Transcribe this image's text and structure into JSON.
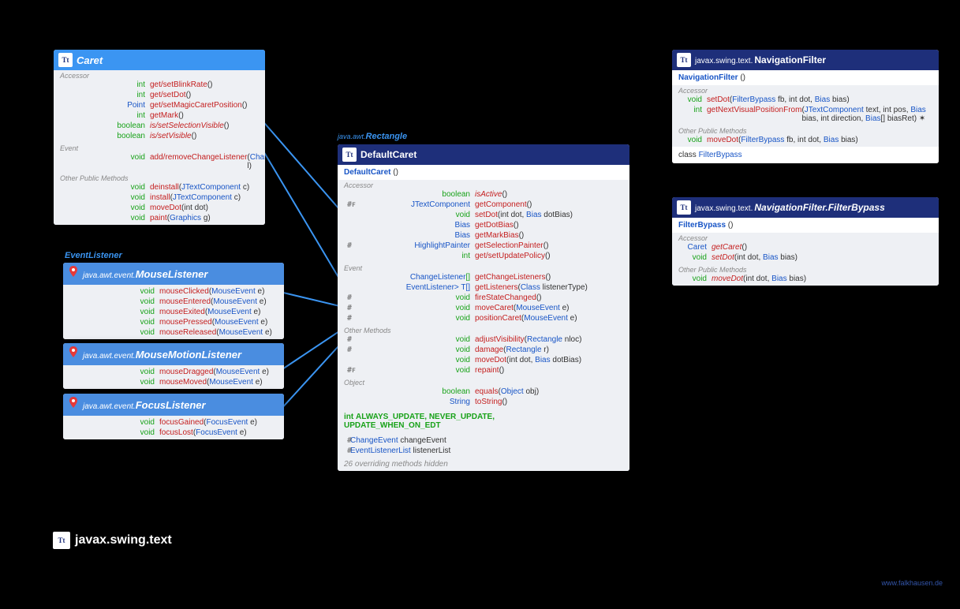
{
  "caret": {
    "title": "Caret",
    "s1": "Accessor",
    "s2": "Event",
    "s3": "Other Public Methods",
    "a": [
      {
        "ret": "int",
        "nm": "get/setBlinkRate",
        "par": "()"
      },
      {
        "ret": "int",
        "nm": "get/setDot",
        "par": "()"
      },
      {
        "ret": "<a>Point</a>",
        "nm": "get/setMagicCaretPosition",
        "par": "()"
      },
      {
        "ret": "int",
        "nm": "getMark",
        "par": "()"
      },
      {
        "ret": "boolean",
        "nm": "is/setSelectionVisible",
        "par": "()",
        "it": 1
      },
      {
        "ret": "boolean",
        "nm": "is/setVisible",
        "par": "()",
        "it": 1
      }
    ],
    "e": [
      {
        "ret": "void",
        "nm": "add/removeChangeListener",
        "par": "(<a>ChangeListener</a> l)"
      }
    ],
    "o": [
      {
        "ret": "void",
        "nm": "deinstall",
        "par": "(<a>JTextComponent</a> c)"
      },
      {
        "ret": "void",
        "nm": "install",
        "par": "(<a>JTextComponent</a> c)"
      },
      {
        "ret": "void",
        "nm": "moveDot",
        "par": "(int dot)"
      },
      {
        "ret": "void",
        "nm": "paint",
        "par": "(<a>Graphics</a> g)"
      }
    ]
  },
  "evl": {
    "label": "EventListener"
  },
  "ml": {
    "pkg": "java.awt.event.",
    "title": "MouseListener",
    "r": [
      {
        "ret": "void",
        "nm": "mouseClicked",
        "par": "(<a>MouseEvent</a> e)"
      },
      {
        "ret": "void",
        "nm": "mouseEntered",
        "par": "(<a>MouseEvent</a> e)"
      },
      {
        "ret": "void",
        "nm": "mouseExited",
        "par": "(<a>MouseEvent</a> e)"
      },
      {
        "ret": "void",
        "nm": "mousePressed",
        "par": "(<a>MouseEvent</a> e)"
      },
      {
        "ret": "void",
        "nm": "mouseReleased",
        "par": "(<a>MouseEvent</a> e)"
      }
    ]
  },
  "mml": {
    "pkg": "java.awt.event.",
    "title": "MouseMotionListener",
    "r": [
      {
        "ret": "void",
        "nm": "mouseDragged",
        "par": "(<a>MouseEvent</a> e)"
      },
      {
        "ret": "void",
        "nm": "mouseMoved",
        "par": "(<a>MouseEvent</a> e)"
      }
    ]
  },
  "fl": {
    "pkg": "java.awt.event.",
    "title": "FocusListener",
    "r": [
      {
        "ret": "void",
        "nm": "focusGained",
        "par": "(<a>FocusEvent</a> e)"
      },
      {
        "ret": "void",
        "nm": "focusLost",
        "par": "(<a>FocusEvent</a> e)"
      }
    ]
  },
  "rect": {
    "pkg": "java.awt.",
    "title": "Rectangle"
  },
  "dc": {
    "title": "DefaultCaret",
    "ctor": "DefaultCaret",
    "ctorPar": " ()",
    "s1": "Accessor",
    "s2": "Event",
    "s3": "Other Methods",
    "s4": "Object",
    "a": [
      {
        "ret": "boolean",
        "nm": "isActive",
        "par": "()",
        "it": 1
      },
      {
        "ret": "<a>JTextComponent</a>",
        "nm": "getComponent",
        "par": "()",
        "mod": "#ꜰ"
      },
      {
        "ret": "void",
        "nm": "setDot",
        "par": "(int dot, <a>Bias</a> dotBias)"
      },
      {
        "ret": "<a>Bias</a>",
        "nm": "getDotBias",
        "par": "()"
      },
      {
        "ret": "<a>Bias</a>",
        "nm": "getMarkBias",
        "par": "()"
      },
      {
        "ret": "<a>HighlightPainter</a>",
        "nm": "getSelectionPainter",
        "par": "()",
        "mod": "#"
      },
      {
        "ret": "int",
        "nm": "get/setUpdatePolicy",
        "par": "()"
      }
    ],
    "e": [
      {
        "ret": "<a>ChangeListener</a>[]",
        "nm": "getChangeListeners",
        "par": "()"
      },
      {
        "ret": "<T extends <a>EventListener</a>> T[]",
        "nm": "getListeners",
        "par": "(<a>Class</a><T> listenerType)"
      },
      {
        "ret": "void",
        "nm": "fireStateChanged",
        "par": "()",
        "mod": "#"
      },
      {
        "ret": "void",
        "nm": "moveCaret",
        "par": "(<a>MouseEvent</a> e)",
        "mod": "#"
      },
      {
        "ret": "void",
        "nm": "positionCaret",
        "par": "(<a>MouseEvent</a> e)",
        "mod": "#"
      }
    ],
    "o": [
      {
        "ret": "void",
        "nm": "adjustVisibility",
        "par": "(<a>Rectangle</a> nloc)",
        "mod": "#"
      },
      {
        "ret": "void",
        "nm": "damage",
        "par": "(<a>Rectangle</a> r)",
        "mod": "#"
      },
      {
        "ret": "void",
        "nm": "moveDot",
        "par": "(int dot, <a>Bias</a> dotBias)"
      },
      {
        "ret": "void",
        "nm": "repaint",
        "par": "()",
        "mod": "#ꜰ"
      }
    ],
    "obj": [
      {
        "ret": "boolean",
        "nm": "equals",
        "par": "(<a>Object</a> obj)"
      },
      {
        "ret": "<a>String</a>",
        "nm": "toString",
        "par": "()"
      }
    ],
    "consts": "int <b>ALWAYS_UPDATE</b>, <b>NEVER_UPDATE</b>,\n    <b>UPDATE_WHEN_ON_EDT</b>",
    "fields": [
      {
        "mod": "#",
        "t": "ChangeEvent",
        "n": "changeEvent"
      },
      {
        "mod": "#",
        "t": "EventListenerList",
        "n": "listenerList"
      }
    ],
    "hidden": "26 overriding methods hidden"
  },
  "nf": {
    "pkg": "javax.swing.text.",
    "title": "NavigationFilter",
    "ctor": "NavigationFilter",
    "ctorPar": " ()",
    "s1": "Accessor",
    "s2": "Other Public Methods",
    "a": [
      {
        "ret": "void",
        "nm": "setDot",
        "par": "(<a>FilterBypass</a> fb, int dot, <a>Bias</a> bias)"
      },
      {
        "ret": "int",
        "nm": "getNextVisualPositionFrom",
        "par": "(<a>JTextComponent</a> text, int pos, <a>Bias</a> bias, int direction, <a>Bias</a>[] biasRet) ✶"
      }
    ],
    "o": [
      {
        "ret": "void",
        "nm": "moveDot",
        "par": "(<a>FilterBypass</a> fb, int dot, <a>Bias</a> bias)"
      }
    ],
    "inner": "class <a>FilterBypass</a>"
  },
  "fb": {
    "pkg": "javax.swing.text.",
    "title": "NavigationFilter.FilterBypass",
    "ctor": "FilterBypass",
    "ctorPar": " ()",
    "s1": "Accessor",
    "s2": "Other Public Methods",
    "a": [
      {
        "ret": "<a>Caret</a>",
        "nm": "getCaret",
        "par": "()",
        "it": 1
      },
      {
        "ret": "void",
        "nm": "setDot",
        "par": "(int dot, <a>Bias</a> bias)",
        "it": 1
      }
    ],
    "o": [
      {
        "ret": "void",
        "nm": "moveDot",
        "par": "(int dot, <a>Bias</a> bias)",
        "it": 1
      }
    ]
  },
  "pkgTitle": "javax.swing.text",
  "credit": "www.falkhausen.de"
}
